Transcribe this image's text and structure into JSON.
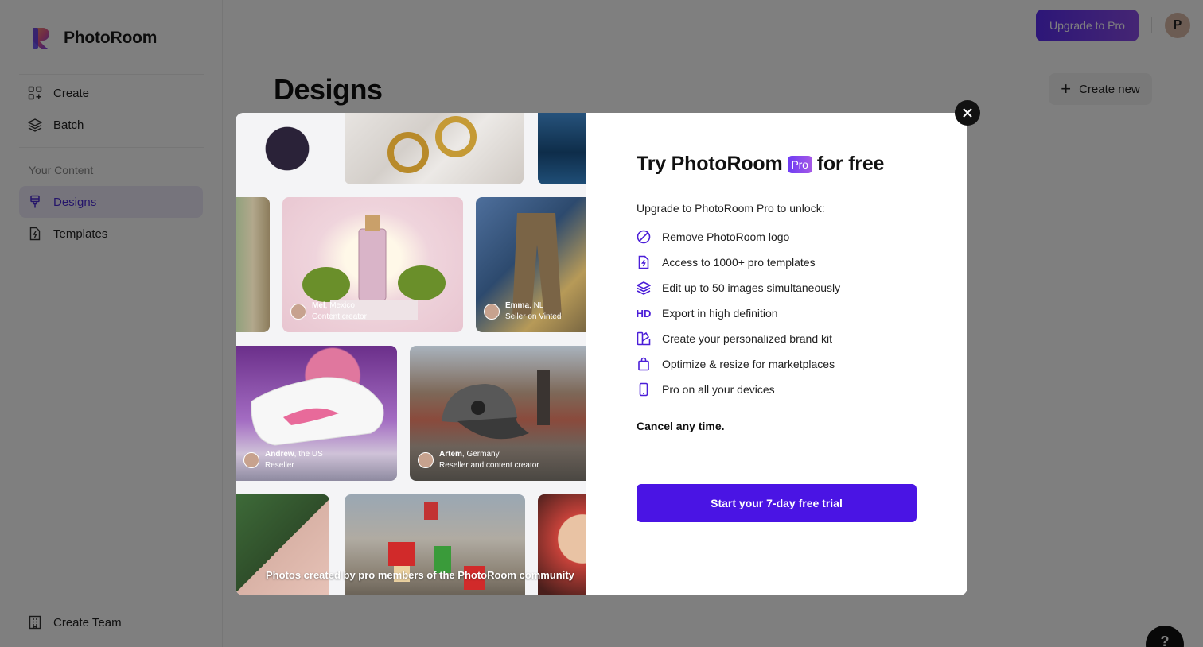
{
  "app": {
    "name": "PhotoRoom"
  },
  "sidebar": {
    "items": [
      {
        "label": "Create",
        "icon": "grid-plus-icon"
      },
      {
        "label": "Batch",
        "icon": "layers-icon"
      }
    ],
    "section_label": "Your Content",
    "content_items": [
      {
        "label": "Designs",
        "icon": "brush-icon",
        "active": true
      },
      {
        "label": "Templates",
        "icon": "template-file-icon",
        "active": false
      }
    ],
    "footer_item": {
      "label": "Create Team",
      "icon": "building-icon"
    }
  },
  "header": {
    "upgrade_label": "Upgrade to Pro",
    "avatar_initial": "P"
  },
  "main": {
    "title": "Designs",
    "create_new_label": "Create new"
  },
  "modal": {
    "title_prefix": "Try PhotoRoom",
    "badge": "Pro",
    "title_suffix": "for free",
    "unlock_label": "Upgrade to PhotoRoom Pro to unlock:",
    "features": [
      {
        "text": "Remove PhotoRoom logo",
        "icon": "no-logo-icon"
      },
      {
        "text": "Access to 1000+ pro templates",
        "icon": "template-icon"
      },
      {
        "text": "Edit up to 50 images simultaneously",
        "icon": "layers-icon"
      },
      {
        "text": "Export in high definition",
        "icon": "hd-icon",
        "glyph": "HD"
      },
      {
        "text": "Create your personalized brand kit",
        "icon": "brand-kit-icon"
      },
      {
        "text": "Optimize & resize for marketplaces",
        "icon": "shopping-bag-icon"
      },
      {
        "text": "Pro on all your devices",
        "icon": "phone-icon"
      }
    ],
    "cancel_text": "Cancel any time.",
    "cta_label": "Start your 7-day free trial",
    "gallery_caption": "Photos created by pro members of the PhotoRoom community",
    "credits": [
      {
        "name": "Mel",
        "location": ", Mexico",
        "role": "Content creator"
      },
      {
        "name": "Emma",
        "location": ", NL",
        "role": "Seller on Vinted"
      },
      {
        "name": "Andrew",
        "location": ", the US",
        "role": "Reseller"
      },
      {
        "name": "Artem",
        "location": ", Germany",
        "role": "Reseller and content creator"
      }
    ]
  },
  "colors": {
    "brand_purple": "#4a14e4",
    "active_nav_bg": "#ece9f9",
    "active_nav_text": "#4a2ad4"
  }
}
